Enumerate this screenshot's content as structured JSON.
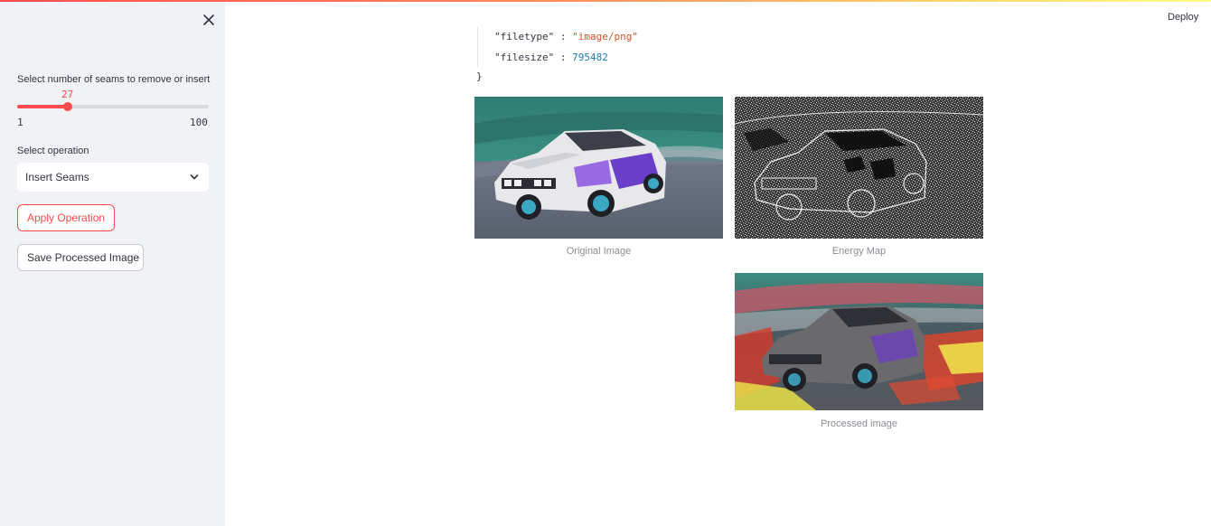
{
  "sidebar": {
    "slider": {
      "label": "Select number of seams to remove or insert",
      "value": "27",
      "min": "1",
      "max": "100",
      "fraction": 0.2626
    },
    "select": {
      "label": "Select operation",
      "value": "Insert Seams"
    },
    "apply_button": "Apply Operation",
    "save_button": "Save Processed Image"
  },
  "header": {
    "deploy_label": "Deploy"
  },
  "json_view": {
    "line1": {
      "key": "\"filetype\"",
      "colon": ":",
      "value": "\"image/png\""
    },
    "line2": {
      "key": "\"filesize\"",
      "colon": ":",
      "value": "795482"
    },
    "close_brace": "}"
  },
  "images": {
    "original_caption": "Original Image",
    "energy_caption": "Energy Map",
    "processed_caption": "Processed image"
  },
  "colors": {
    "accent": "#ff4b4b",
    "sidebar_bg": "#f0f2f6"
  }
}
